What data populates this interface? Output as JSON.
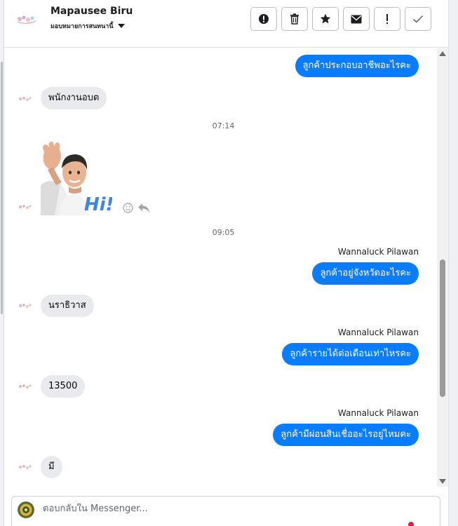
{
  "header": {
    "name": "Mapausee Biru",
    "subtitle": "มอบหมายการสนทนานี้",
    "actions": [
      {
        "icon": "alert-circle-icon",
        "label": "mark-spam"
      },
      {
        "icon": "trash-icon",
        "label": "delete"
      },
      {
        "icon": "star-icon",
        "label": "star"
      },
      {
        "icon": "envelope-icon",
        "label": "mark-unread"
      },
      {
        "icon": "exclamation-icon",
        "label": "follow-up"
      },
      {
        "icon": "check-icon",
        "label": "done"
      }
    ]
  },
  "messages": {
    "m1": "ลูกค้าประกอบอาชีพอะไรคะ",
    "m2": "พนักงานอบต",
    "ts1": "07:14",
    "sticker_text": "Hi!",
    "ts2": "09:05",
    "sender1": "Wannaluck Pilawan",
    "m3": "ลูกค้าอยู่จังหวัดอะไรคะ",
    "m4": "นราธิวาส",
    "sender2": "Wannaluck Pilawan",
    "m5": "ลูกค้ารายได้ต่อเดือนเท่าไหรคะ",
    "m6": "13500",
    "sender3": "Wannaluck Pilawan",
    "m7": "ลูกค้ามีผ่อนสินเชื่ออะไรอยู่ไหมคะ",
    "m8": "มี"
  },
  "composer": {
    "placeholder": "ตอบกลับใน Messenger..."
  },
  "colors": {
    "outgoing_bubble": "#0a7cff",
    "incoming_bubble": "#e9eaed",
    "timestamp": "#65676b"
  }
}
